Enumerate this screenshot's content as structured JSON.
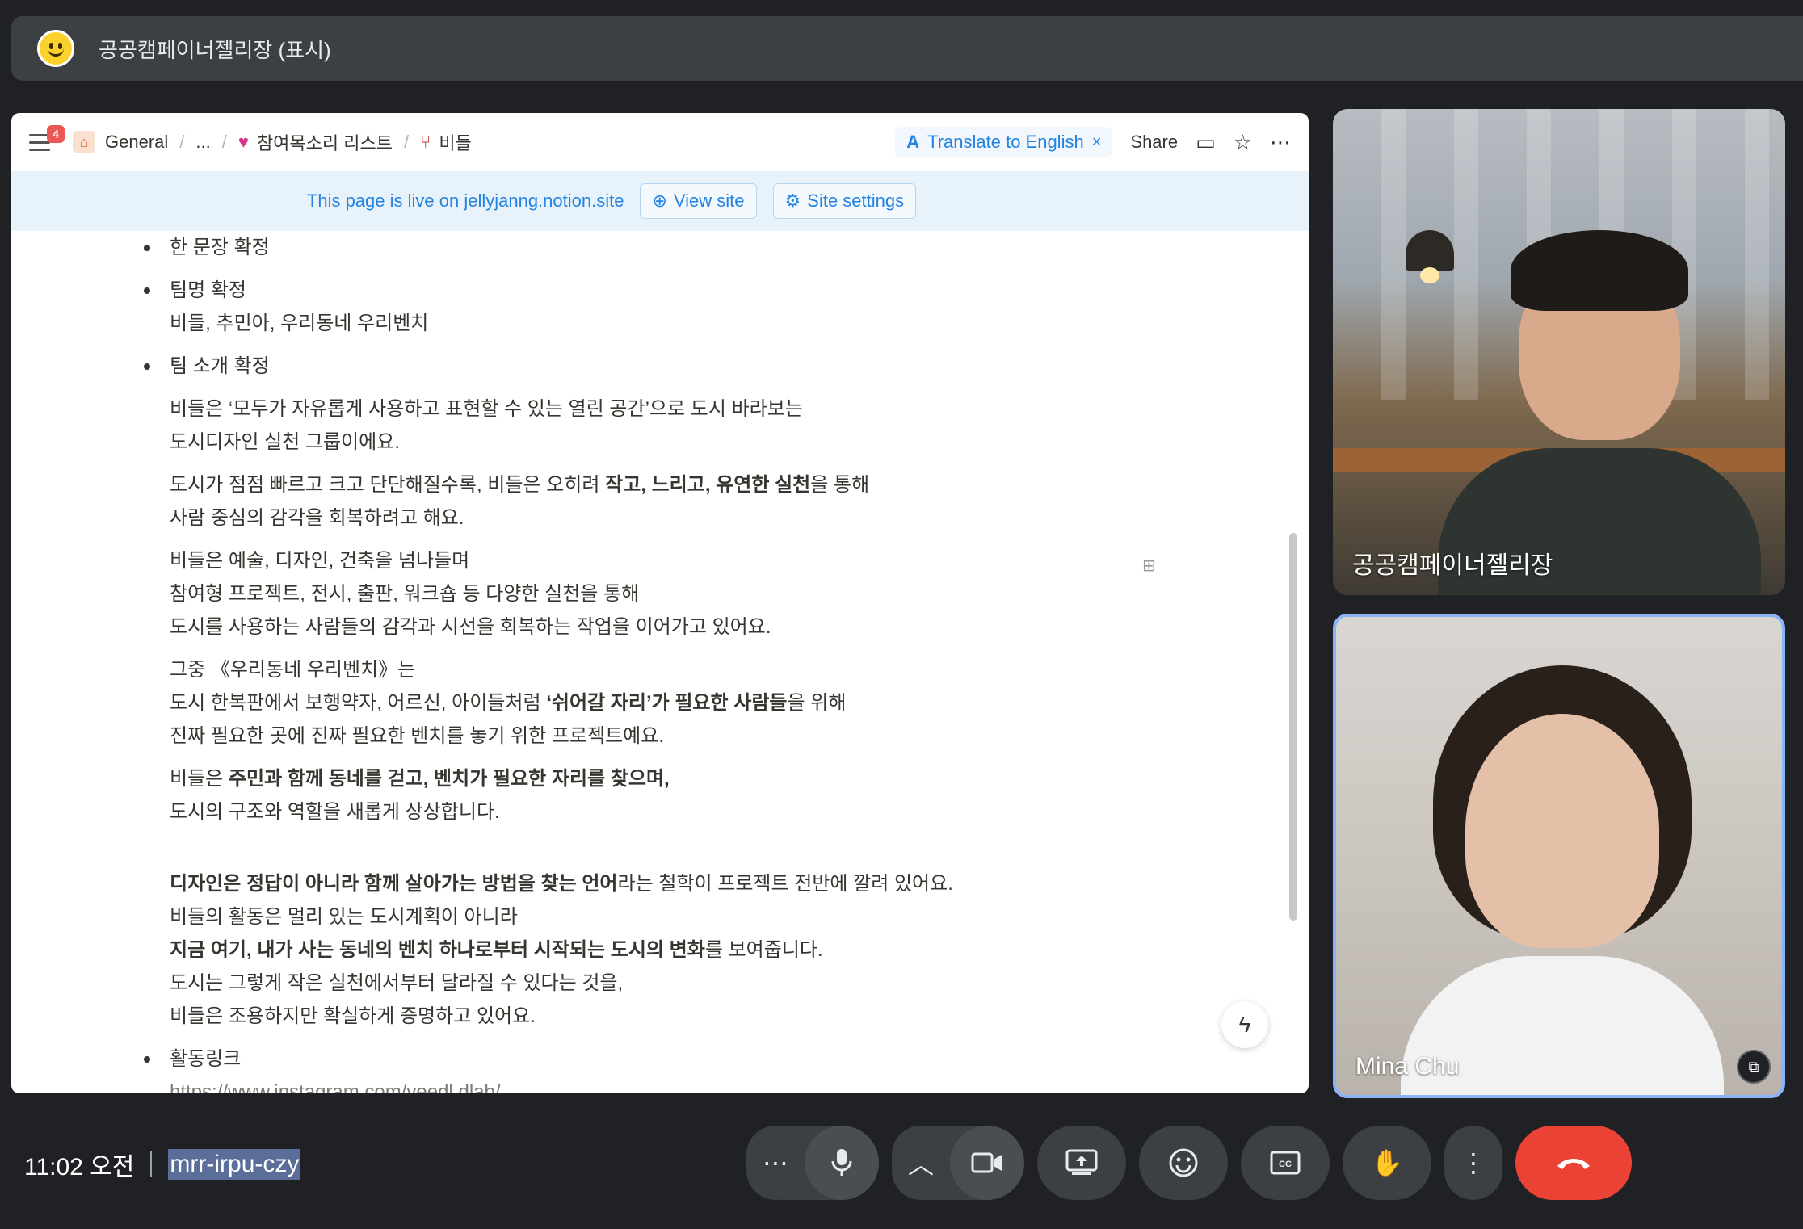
{
  "presenter_bar": {
    "title": "공공캠페이너젤리장 (표시)",
    "avatar_icon": "smiley-emoji-icon"
  },
  "notion": {
    "menu_badge": "4",
    "breadcrumbs": [
      {
        "label": "General",
        "icon": "home-icon"
      },
      {
        "label": "...",
        "icon": ""
      },
      {
        "label": "참여목소리 리스트",
        "icon": "heart-icon"
      },
      {
        "label": "비들",
        "icon": "chair-icon"
      }
    ],
    "translate_label": "Translate to English",
    "translate_prefix": "A",
    "share_label": "Share",
    "banner_text": "This page is live on jellyjanng.notion.site",
    "view_site_label": "View site",
    "site_settings_label": "Site settings",
    "bullets": {
      "b1": "한 문장 확정",
      "b2": "팀명 확정",
      "b2_sub": "비들, 추민아, 우리동네 우리벤치",
      "b3": "팀 소개 확정",
      "b4": "활동링크",
      "b4_link": "https://www.instagram.com/veedl.dlab/"
    },
    "paragraphs": {
      "p1a": "비들은 ‘모두가 자유롭게 사용하고 표현할 수 있는 열린 공간’으로 도시 바라보는",
      "p1b": "도시디자인 실천 그룹이에요.",
      "p2a_1": "도시가 점점 빠르고 크고 단단해질수록, 비들은 오히려 ",
      "p2a_bold": "작고, 느리고, 유연한 실천",
      "p2a_2": "을 통해",
      "p2b": "사람 중심의 감각을 회복하려고 해요.",
      "p3a": "비들은 예술, 디자인, 건축을 넘나들며",
      "p3b": "참여형 프로젝트, 전시, 출판, 워크숍 등 다양한 실천을 통해",
      "p3c": "도시를 사용하는 사람들의 감각과 시선을 회복하는 작업을 이어가고 있어요.",
      "p4a": "그중 《우리동네 우리벤치》는",
      "p4b_1": "도시 한복판에서 보행약자, 어르신, 아이들처럼 ",
      "p4b_bold": "‘쉬어갈 자리’가 필요한 사람들",
      "p4b_2": "을 위해",
      "p4c": "진짜 필요한 곳에 진짜 필요한 벤치를 놓기 위한 프로젝트예요.",
      "p5a_1": "비들은 ",
      "p5a_bold": "주민과 함께 동네를 걷고, 벤치가 필요한 자리를 찾으며,",
      "p5b": "도시의 구조와 역할을 새롭게 상상합니다.",
      "p6a_bold": "디자인은 정답이 아니라 함께 살아가는 방법을 찾는 언어",
      "p6a_2": "라는 철학이 프로젝트 전반에 깔려 있어요.",
      "p6b": "비들의 활동은 멀리 있는 도시계획이 아니라",
      "p6c_bold": "지금 여기, 내가 사는 동네의 벤치 하나로부터 시작되는 도시의 변화",
      "p6c_2": "를 보여줍니다.",
      "p6d": "도시는 그렇게 작은 실천에서부터 달라질 수 있다는 것을,",
      "p6e": "비들은 조용하지만 확실하게 증명하고 있어요."
    }
  },
  "participants": [
    {
      "name": "공공캠페이너젤리장"
    },
    {
      "name": "Mina Chu"
    }
  ],
  "footer": {
    "time": "11:02 오전",
    "meeting_code": "mrr-irpu-czy"
  },
  "colors": {
    "accent_blue": "#2383e2",
    "end_call_red": "#ea4335",
    "active_tile_border": "#8ab4f8"
  }
}
